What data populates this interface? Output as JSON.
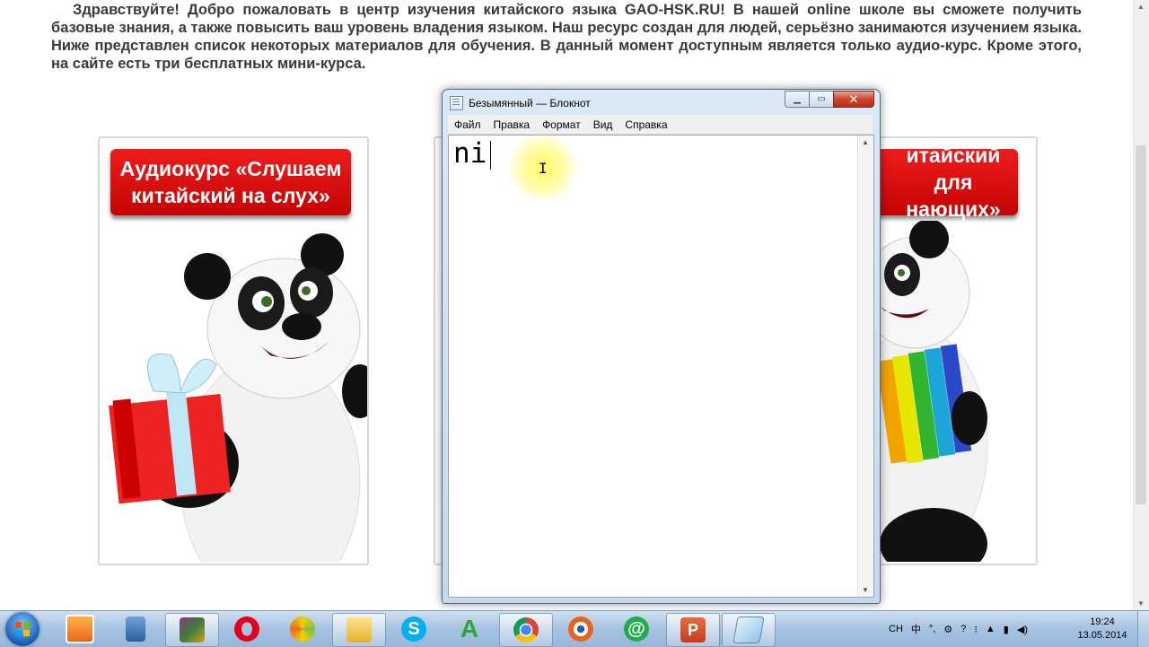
{
  "page": {
    "intro": "Здравствуйте! Добро пожаловать в центр изучения китайского языка GAO-HSK.RU! В нашей online школе вы сможете получить базовые знания, а также повысить ваш уровень владения языком. Наш ресурс создан для людей, серьёзно занимаются изучением языка. Ниже представлен список некоторых материалов для обучения. В данный момент доступным является только аудио-курс. Кроме этого, на сайте есть три бесплатных мини-курса.",
    "cards": [
      {
        "line1": "Аудиокурс «Слушаем",
        "line2": "китайский на слух»"
      },
      {
        "line1": "итайский для",
        "line2": "нающих»"
      }
    ]
  },
  "notepad": {
    "title": "Безымянный — Блокнот",
    "menu": [
      "Файл",
      "Правка",
      "Формат",
      "Вид",
      "Справка"
    ],
    "content": "ni"
  },
  "taskbar": {
    "apps": [
      "media-player-icon",
      "explorer-icon",
      "winrar-icon",
      "opera-icon",
      "disc-icon",
      "folder-icon",
      "skype-icon",
      "abbyy-icon",
      "chrome-icon",
      "screen-recorder-icon",
      "mail-agent-icon",
      "powerpoint-icon",
      "notepad-icon"
    ],
    "tray": {
      "lang": "CH"
    },
    "time": "19:24",
    "date": "13.05.2014"
  }
}
